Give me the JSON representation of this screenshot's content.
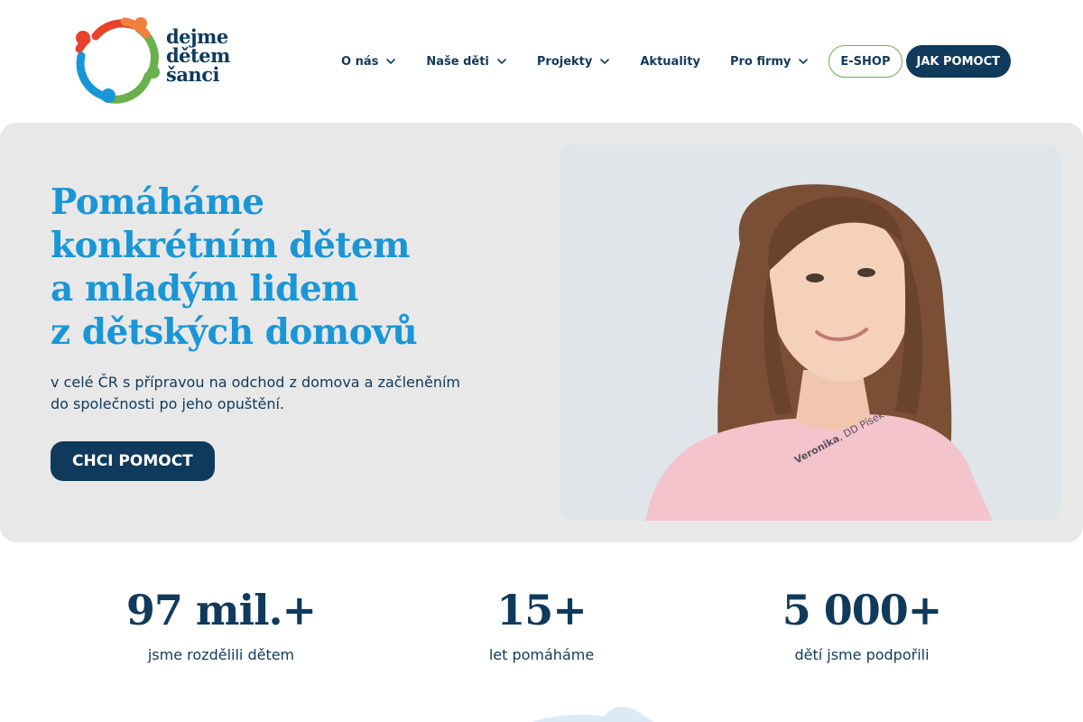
{
  "brand": {
    "logo_lines": [
      "dejme",
      "dětem",
      "šanci"
    ],
    "colors": {
      "navy": "#0f3a5c",
      "blue": "#1996d5",
      "green": "#6ab04c",
      "red": "#e8412c",
      "orange": "#f07f3c"
    }
  },
  "nav": {
    "items": [
      {
        "label": "O nás",
        "dropdown": true
      },
      {
        "label": "Naše děti",
        "dropdown": true
      },
      {
        "label": "Projekty",
        "dropdown": true
      },
      {
        "label": "Aktuality",
        "dropdown": false
      },
      {
        "label": "Pro firmy",
        "dropdown": true
      }
    ],
    "eshop_label": "E-SHOP",
    "help_label": "JAK POMOCT",
    "dropdown_icon": "chevron-down-icon"
  },
  "hero": {
    "title_lines": [
      "Pomáháme",
      "konkrétním dětem",
      "a mladým lidem",
      "z dětských domovů"
    ],
    "subtitle_lines": [
      "v celé ČR s přípravou na odchod z domova a začleněním",
      "do společnosti po jeho opuštění."
    ],
    "cta_label": "CHCI POMOCT",
    "photo_caption_name": "Veronika",
    "photo_caption_place": ", DD Písek"
  },
  "stats": [
    {
      "value": "97 mil.+",
      "label": "jsme rozdělili dětem"
    },
    {
      "value": "15+",
      "label": "let pomáháme"
    },
    {
      "value": "5 000+",
      "label": "dětí jsme podpořili"
    }
  ]
}
